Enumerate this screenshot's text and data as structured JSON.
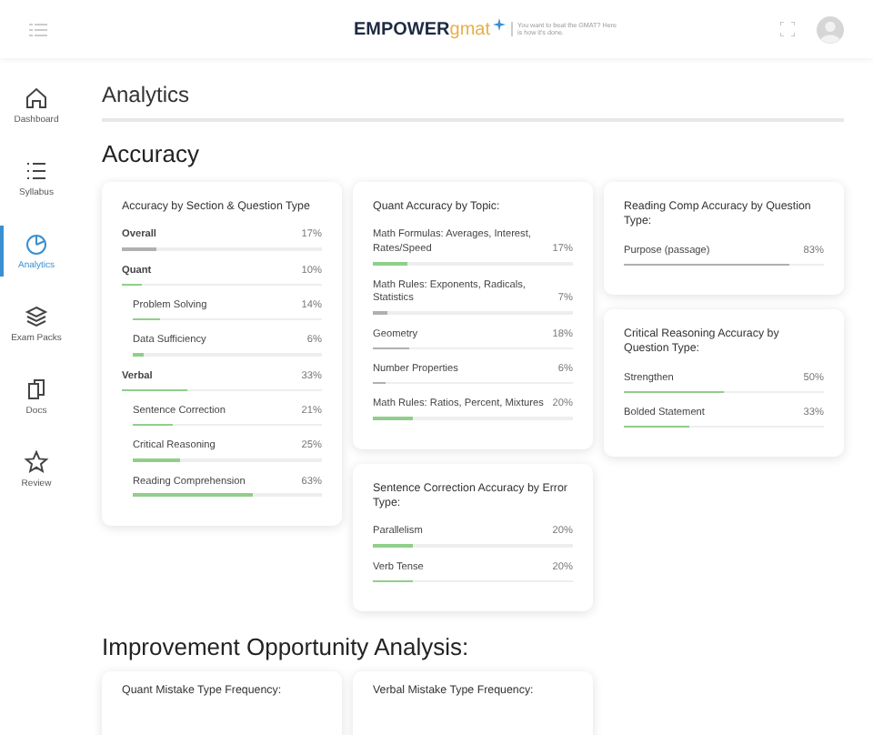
{
  "header": {
    "logo_main": "EMPOWER",
    "logo_accent": "gmat",
    "tagline": "You want to beat the GMAT? Here is how it's done."
  },
  "sidebar": {
    "items": [
      {
        "label": "Dashboard",
        "selected": false
      },
      {
        "label": "Syllabus",
        "selected": false
      },
      {
        "label": "Analytics",
        "selected": true
      },
      {
        "label": "Exam Packs",
        "selected": false
      },
      {
        "label": "Docs",
        "selected": false
      },
      {
        "label": "Review",
        "selected": false
      }
    ]
  },
  "page_title": "Analytics",
  "accuracy": {
    "title": "Accuracy",
    "columns": [
      [
        {
          "title": "Accuracy by Section & Question Type",
          "rows": [
            {
              "name": "Overall",
              "value": "17%",
              "level": 0.17,
              "color": "#b0b0b0"
            },
            {
              "name": "Quant",
              "value": "10%",
              "level": 0.1,
              "color": "#8fcf8a",
              "children": [
                {
                  "name": "Problem Solving",
                  "value": "14%",
                  "level": 0.14,
                  "color": "#8fcf8a"
                },
                {
                  "name": "Data Sufficiency",
                  "value": "6%",
                  "level": 0.06,
                  "color": "#8fcf8a"
                }
              ]
            },
            {
              "name": "Verbal",
              "value": "33%",
              "level": 0.33,
              "color": "#8fcf8a",
              "children": [
                {
                  "name": "Sentence Correction",
                  "value": "21%",
                  "level": 0.21,
                  "color": "#8fcf8a"
                },
                {
                  "name": "Critical Reasoning",
                  "value": "25%",
                  "level": 0.25,
                  "color": "#8fcf8a"
                },
                {
                  "name": "Reading Comprehension",
                  "value": "63%",
                  "level": 0.63,
                  "color": "#8fcf8a"
                }
              ]
            }
          ]
        }
      ],
      [
        {
          "title": "Quant Accuracy by Topic:",
          "rows": [
            {
              "name": "Math Formulas: Averages, Interest, Rates/Speed",
              "value": "17%",
              "level": 0.17,
              "color": "#8fcf8a"
            },
            {
              "name": "Math Rules: Exponents, Radicals, Statistics",
              "value": "7%",
              "level": 0.07,
              "color": "#b0b0b0"
            },
            {
              "name": "Geometry",
              "value": "18%",
              "level": 0.18,
              "color": "#b0b0b0"
            },
            {
              "name": "Number Properties",
              "value": "6%",
              "level": 0.06,
              "color": "#b0b0b0"
            },
            {
              "name": "Math Rules: Ratios, Percent, Mixtures",
              "value": "20%",
              "level": 0.2,
              "color": "#8fcf8a"
            }
          ]
        },
        {
          "title": "Sentence Correction Accuracy by Error Type:",
          "rows": [
            {
              "name": "Parallelism",
              "value": "20%",
              "level": 0.2,
              "color": "#8fcf8a"
            },
            {
              "name": "Verb Tense",
              "value": "20%",
              "level": 0.2,
              "color": "#8fcf8a"
            }
          ]
        }
      ],
      [
        {
          "title": "Reading Comp Accuracy by Question Type:",
          "rows": [
            {
              "name": "Purpose (passage)",
              "value": "83%",
              "level": 0.83,
              "color": "#b0b0b0"
            }
          ]
        },
        {
          "title": "Critical Reasoning Accuracy by Question Type:",
          "rows": [
            {
              "name": "Strengthen",
              "value": "50%",
              "level": 0.5,
              "color": "#8fcf8a"
            },
            {
              "name": "Bolded Statement",
              "value": "33%",
              "level": 0.33,
              "color": "#8fcf8a"
            }
          ]
        }
      ]
    ]
  },
  "improvement": {
    "title": "Improvement Opportunity Analysis:",
    "cards": [
      {
        "title": "Quant Mistake Type Frequency:"
      },
      {
        "title": "Verbal Mistake Type Frequency:"
      }
    ]
  }
}
